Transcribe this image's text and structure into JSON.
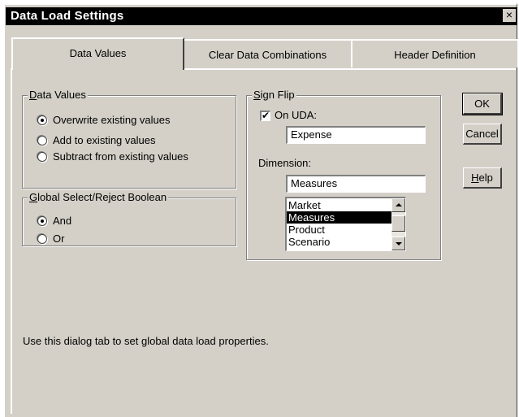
{
  "window": {
    "title": "Data Load Settings",
    "close_glyph": "×"
  },
  "tabs": [
    {
      "label": "Data Values",
      "active": true
    },
    {
      "label": "Clear Data Combinations",
      "active": false
    },
    {
      "label": "Header Definition",
      "active": false
    }
  ],
  "data_values_group": {
    "label_accel": "D",
    "label_rest": "ata Values",
    "options": [
      {
        "label": "Overwrite existing values",
        "checked": true
      },
      {
        "label": "Add to existing values",
        "checked": false
      },
      {
        "label": "Subtract from existing values",
        "checked": false
      }
    ]
  },
  "boolean_group": {
    "label_accel": "G",
    "label_rest": "lobal Select/Reject Boolean",
    "options": [
      {
        "label": "And",
        "checked": true
      },
      {
        "label": "Or",
        "checked": false
      }
    ]
  },
  "sign_flip_group": {
    "label_accel": "S",
    "label_rest": "ign Flip",
    "on_uda_label": "On UDA:",
    "on_uda_checked": true,
    "check_glyph": "✔",
    "uda_value": "Expense",
    "dimension_label": "Dimension:",
    "dimension_value": "Measures",
    "dimension_list": [
      "Market",
      "Measures",
      "Product",
      "Scenario"
    ],
    "selected_index": 1
  },
  "buttons": {
    "ok": "OK",
    "cancel": "Cancel",
    "help_accel": "H",
    "help_rest": "elp"
  },
  "description": "Use this dialog tab to set global data load properties."
}
